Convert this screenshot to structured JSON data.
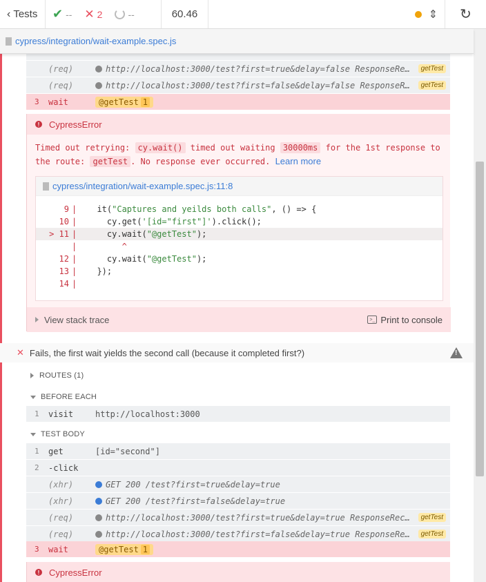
{
  "topbar": {
    "back_label": "Tests",
    "passed": "--",
    "failed": "2",
    "pending": "--",
    "duration": "60.46"
  },
  "spec": {
    "path": "cypress/integration/wait-example.spec.js"
  },
  "test1": {
    "rows": [
      {
        "nm": "(req)",
        "msg": "http://localhost:3000/test?first=true&delay=false ResponseRe…",
        "alias": "getTest"
      },
      {
        "nm": "(req)",
        "msg": "http://localhost:3000/test?first=false&delay=false ResponseR…",
        "alias": "getTest"
      }
    ],
    "wait": {
      "num": "3",
      "nm": "wait",
      "alias": "@getTest",
      "count": "1"
    },
    "error": {
      "title": "CypressError",
      "msg_a": "Timed out retrying: ",
      "code_a": "cy.wait()",
      "msg_b": " timed out waiting ",
      "code_b": "30000ms",
      "msg_c": " for the 1st response to the route: ",
      "code_c": "getTest",
      "msg_d": ". No response ever occurred. ",
      "learn_more": "Learn more",
      "frame_path": "cypress/integration/wait-example.spec.js:11:8",
      "code_lines": [
        {
          "ln": "9",
          "pre": "  it(",
          "str": "\"Captures and yeilds both calls\"",
          "post": ", () => {"
        },
        {
          "ln": "10",
          "pre": "    cy.get(",
          "str": "'[id=\"first\"]'",
          "post": ").click();"
        },
        {
          "ln": "11",
          "pre": "    cy.wait(",
          "str": "\"@getTest\"",
          "post": ");"
        },
        {
          "ln": "12",
          "pre": "    cy.wait(",
          "str": "\"@getTest\"",
          "post": ");"
        },
        {
          "ln": "13",
          "pre": "  });",
          "str": "",
          "post": ""
        },
        {
          "ln": "14",
          "pre": "",
          "str": "",
          "post": ""
        }
      ],
      "caret": "^",
      "current_marker": ">",
      "view_stack": "View stack trace",
      "print_console": "Print to console"
    }
  },
  "test2": {
    "title": "Fails, the first wait yields the second call (because it completed first?)",
    "routes_label": "ROUTES (1)",
    "before_each_label": "BEFORE EACH",
    "visit": {
      "num": "1",
      "nm": "visit",
      "msg": "http://localhost:3000"
    },
    "test_body_label": "TEST BODY",
    "get": {
      "num": "1",
      "nm": "get",
      "msg": "[id=\"second\"]"
    },
    "click": {
      "num": "2",
      "nm": "-click"
    },
    "xhr_rows": [
      {
        "nm": "(xhr)",
        "msg": "GET 200 /test?first=true&delay=true"
      },
      {
        "nm": "(xhr)",
        "msg": "GET 200 /test?first=false&delay=true"
      }
    ],
    "req_rows": [
      {
        "nm": "(req)",
        "msg": "http://localhost:3000/test?first=true&delay=true ResponseRec…",
        "alias": "getTest"
      },
      {
        "nm": "(req)",
        "msg": "http://localhost:3000/test?first=false&delay=true ResponseRe…",
        "alias": "getTest"
      }
    ],
    "wait": {
      "num": "3",
      "nm": "wait",
      "alias": "@getTest",
      "count": "1"
    },
    "error_title": "CypressError"
  }
}
